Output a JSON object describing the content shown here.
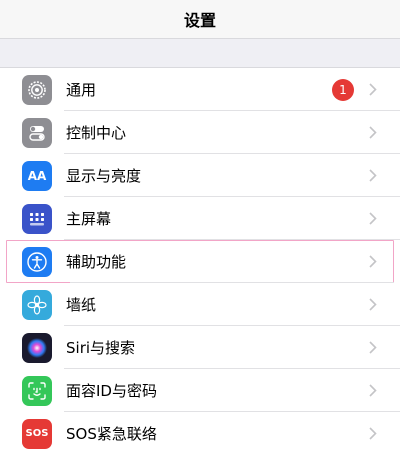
{
  "nav": {
    "title": "设置"
  },
  "items": [
    {
      "label": "通用",
      "icon": "gear-icon",
      "color": "#8e8e93",
      "badge": "1"
    },
    {
      "label": "控制中心",
      "icon": "toggle-switches-icon",
      "color": "#8e8e93"
    },
    {
      "label": "显示与亮度",
      "icon": "text-size-icon",
      "color": "#1e7cf2",
      "icon_text": "AA"
    },
    {
      "label": "主屏幕",
      "icon": "app-grid-icon",
      "color": "#3a53c9"
    },
    {
      "label": "辅助功能",
      "icon": "accessibility-icon",
      "color": "#1e7cf2"
    },
    {
      "label": "墙纸",
      "icon": "flower-icon",
      "color": "#35aadc"
    },
    {
      "label": "Siri与搜索",
      "icon": "siri-icon",
      "color": "#1a1a2e"
    },
    {
      "label": "面容ID与密码",
      "icon": "face-id-icon",
      "color": "#34c759"
    },
    {
      "label": "SOS紧急联络",
      "icon": "sos-icon",
      "color": "#e53935",
      "icon_text": "SOS"
    }
  ]
}
